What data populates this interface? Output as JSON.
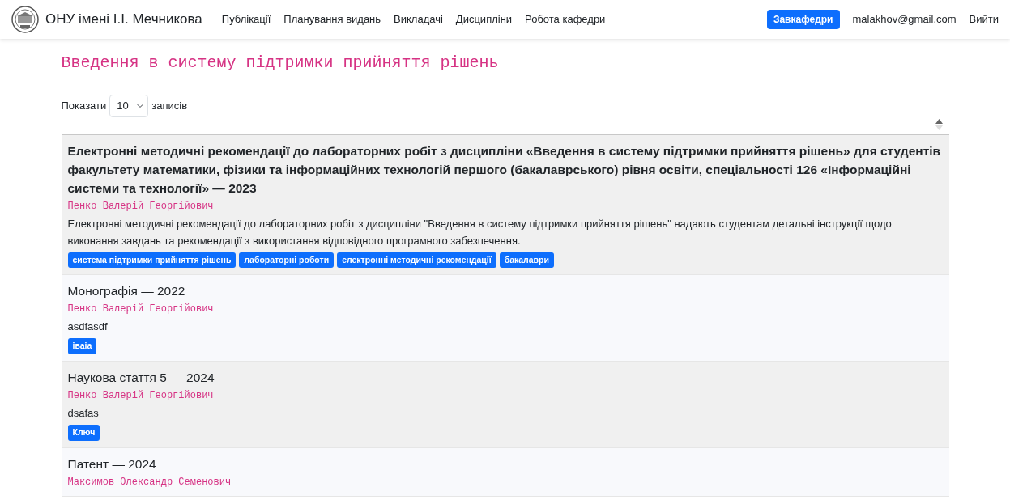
{
  "navbar": {
    "brand": "ОНУ імені І.І. Мечникова",
    "links": [
      "Публікації",
      "Планування видань",
      "Викладачі",
      "Дисципліни",
      "Робота кафедри"
    ],
    "role_badge": "Завкафедри",
    "email": "malakhov@gmail.com",
    "logout": "Вийти"
  },
  "page": {
    "title": "Введення в систему підтримки прийняття рішень"
  },
  "length_control": {
    "before": "Показати",
    "value": "10",
    "after": "записів"
  },
  "table": {
    "rows": [
      {
        "title": "Електронні методичні рекомендації до лабораторних робіт з дисципліни «Введення в систему підтримки прийняття рішень» для студентів факультету математики, фізики та інформаційних технологій першого (бакалаврського) рівня освіти, спеціальності 126 «Інформаційні системи та технології» — 2023",
        "author": "Пенко Валерій Георгійович",
        "description": "Електронні методичні рекомендації до лабораторних робіт з дисципліни \"Введення в систему підтримки прийняття рішень\" надають студентам детальні інструкції щодо виконання завдань та рекомендації з використання відповідного програмного забезпечення.",
        "tags": [
          "система підтримки прийняття рішень",
          "лабораторні роботи",
          "електронні методичні рекомендації",
          "бакалаври"
        ]
      },
      {
        "title": "Монографія — 2022",
        "author": "Пенко Валерій Георгійович",
        "description": "asdfasdf",
        "tags": [
          "іваіа"
        ]
      },
      {
        "title": "Наукова стаття 5 — 2024",
        "author": "Пенко Валерій Георгійович",
        "description": "dsafas",
        "tags": [
          "Ключ"
        ]
      },
      {
        "title": "Патент — 2024",
        "author": "Максимов Олександр Семенович"
      }
    ]
  }
}
